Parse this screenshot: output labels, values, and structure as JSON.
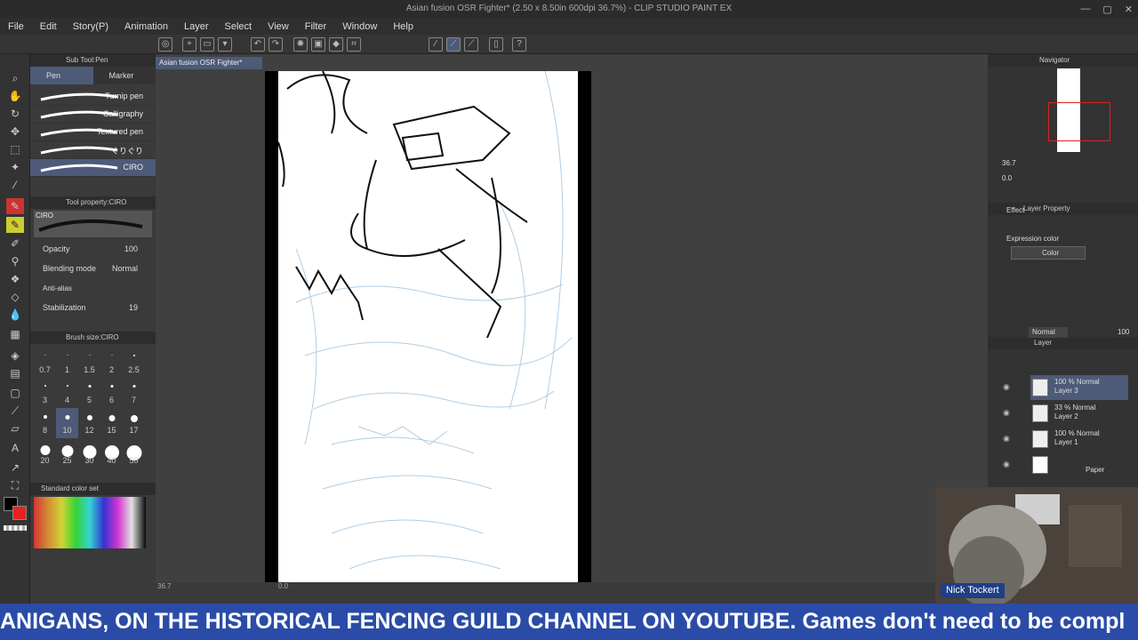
{
  "window": {
    "title": "Asian fusion OSR Fighter* (2.50 x 8.50in 600dpi 36.7%) - CLIP STUDIO PAINT EX",
    "controls": [
      "—",
      "▢",
      "✕"
    ]
  },
  "menu": [
    "File",
    "Edit",
    "Story(P)",
    "Animation",
    "Layer",
    "Select",
    "View",
    "Filter",
    "Window",
    "Help"
  ],
  "subtool": {
    "header": "Sub Tool:Pen",
    "tabs": [
      "Pen",
      "Marker"
    ],
    "brushes": [
      "Turnip pen",
      "Calligraphy",
      "Textured pen",
      "ぐりぐり",
      "CIRO"
    ]
  },
  "tool_property": {
    "header": "Tool property:CIRO",
    "brush_name": "CIRO",
    "opacity_label": "Opacity",
    "opacity_value": "100",
    "blending_label": "Blending mode",
    "blending_value": "Normal",
    "antialias_label": "Anti-alias",
    "stabilization_label": "Stabilization",
    "stabilization_value": "19"
  },
  "brush_size": {
    "header": "Brush size:CIRO",
    "sizes": [
      "0.7",
      "1",
      "1.5",
      "2",
      "2.5",
      "3",
      "4",
      "5",
      "6",
      "7",
      "8",
      "10",
      "12",
      "15",
      "17",
      "20",
      "25",
      "30",
      "40",
      "50"
    ],
    "selected": "10"
  },
  "color_set": {
    "label": "Standard color set"
  },
  "document": {
    "tab": "Asian fusion OSR Fighter*",
    "zoom": "36.7",
    "angle": "0.0"
  },
  "navigator": {
    "header": "Navigator",
    "zoom": "36.7",
    "angle": "0.0"
  },
  "layer_property": {
    "header": "Layer Property",
    "effect_label": "Effect",
    "expression_label": "Expression color",
    "expression_value": "Color"
  },
  "layers": {
    "header": "Layer",
    "blend": "Normal",
    "opacity": "100",
    "items": [
      {
        "line1": "100 % Normal",
        "line2": "Layer 3",
        "selected": true
      },
      {
        "line1": "33 % Normal",
        "line2": "Layer 2",
        "selected": false
      },
      {
        "line1": "100 % Normal",
        "line2": "Layer 1",
        "selected": false
      },
      {
        "line1": "",
        "line2": "Paper",
        "selected": false
      }
    ]
  },
  "webcam": {
    "name": "Nick Tockert"
  },
  "ticker": {
    "text": "ANIGANS, ON THE HISTORICAL FENCING GUILD CHANNEL ON YOUTUBE. Games don't need to be compl"
  },
  "colors": {
    "accent_select": "#4d5a78",
    "ticker_bg": "#2a4ca8",
    "main_color": "#000000",
    "sub_color": "#e82020"
  }
}
